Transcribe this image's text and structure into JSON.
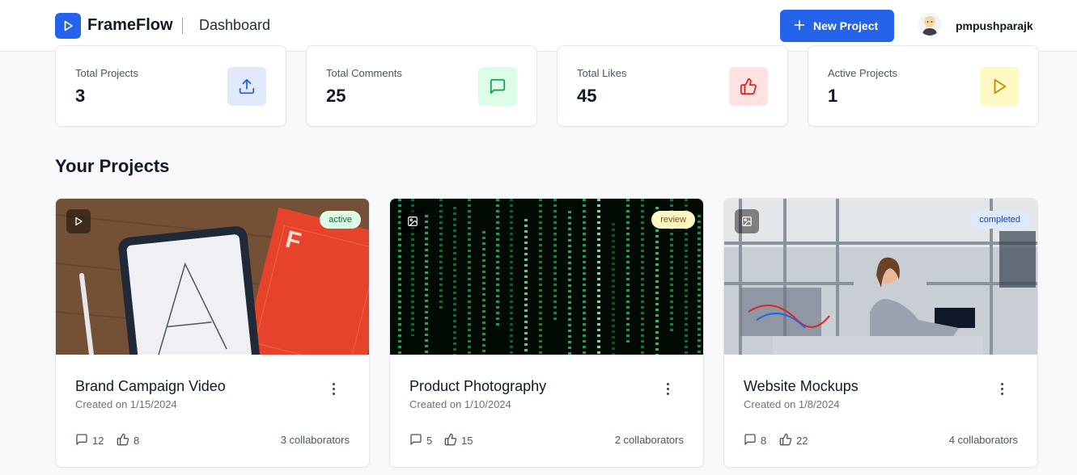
{
  "header": {
    "brand": "FrameFlow",
    "page_title": "Dashboard",
    "new_project_label": "New Project",
    "username": "pmpushparajk",
    "brand_color": "#2563eb"
  },
  "stats": [
    {
      "label": "Total Projects",
      "value": "3",
      "icon": "upload-icon",
      "color": "#2563eb"
    },
    {
      "label": "Total Comments",
      "value": "25",
      "icon": "message-icon",
      "color": "#16a34a"
    },
    {
      "label": "Total Likes",
      "value": "45",
      "icon": "thumbs-up-icon",
      "color": "#dc2626"
    },
    {
      "label": "Active Projects",
      "value": "1",
      "icon": "play-icon",
      "color": "#ca8a04"
    }
  ],
  "section_title": "Your Projects",
  "projects": [
    {
      "title": "Brand Campaign Video",
      "date": "Created on 1/15/2024",
      "status": "active",
      "type_icon": "video-icon",
      "comments": "12",
      "likes": "8",
      "collaborators": "3 collaborators"
    },
    {
      "title": "Product Photography",
      "date": "Created on 1/10/2024",
      "status": "review",
      "type_icon": "image-icon",
      "comments": "5",
      "likes": "15",
      "collaborators": "2 collaborators"
    },
    {
      "title": "Website Mockups",
      "date": "Created on 1/8/2024",
      "status": "completed",
      "type_icon": "image-icon",
      "comments": "8",
      "likes": "22",
      "collaborators": "4 collaborators"
    }
  ]
}
